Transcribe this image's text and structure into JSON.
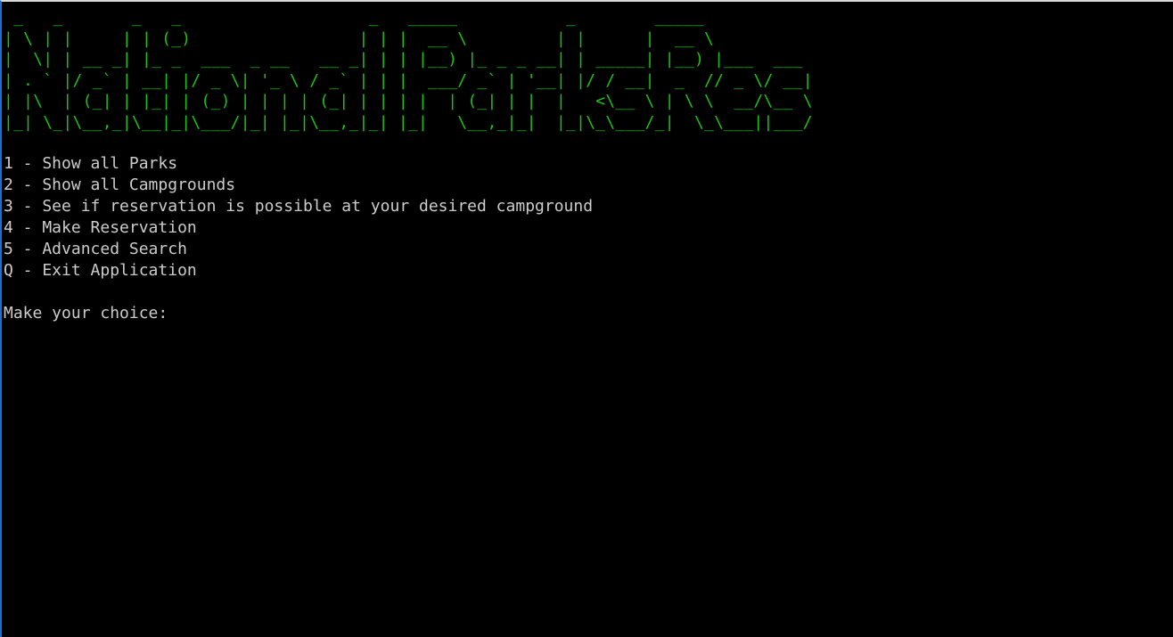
{
  "banner": {
    "ascii_art": " _   _       _   _                   _   _____           _        _____            \n| \\ | |     | | (_)                 | | |  __ \\         | |      |  __ \\           \n|  \\| | __ _| |_ _  ___  _ __   __ _| | | |__) |_ _ _ __| | _____| |__) |___  ___ \n| . ` |/ _` | __| |/ _ \\| '_ \\ / _` | | |  ___/ _` | '__| |/ / __|  _  // _ \\/ __|\n| |\\  | (_| | |_| | (_) | | | | (_| | | | |  | (_| | |  |   <\\__ \\ | \\ \\  __/\\__ \\\n|_| \\_|\\__,_|\\__|_|\\___/|_| |_|\\__,_|_| |_|   \\__,_|_|  |_|\\_\\___/_|  \\_\\___||___/",
    "color": "#16c60c"
  },
  "menu": {
    "items": [
      {
        "key": "1",
        "text": "1 - Show all Parks"
      },
      {
        "key": "2",
        "text": "2 - Show all Campgrounds"
      },
      {
        "key": "3",
        "text": "3 - See if reservation is possible at your desired campground"
      },
      {
        "key": "4",
        "text": "4 - Make Reservation"
      },
      {
        "key": "5",
        "text": "5 - Advanced Search"
      },
      {
        "key": "Q",
        "text": "Q - Exit Application"
      }
    ]
  },
  "prompt": {
    "text": "Make your choice:",
    "input_value": ""
  },
  "colors": {
    "background": "#000000",
    "text": "#cccccc",
    "banner": "#16c60c"
  }
}
